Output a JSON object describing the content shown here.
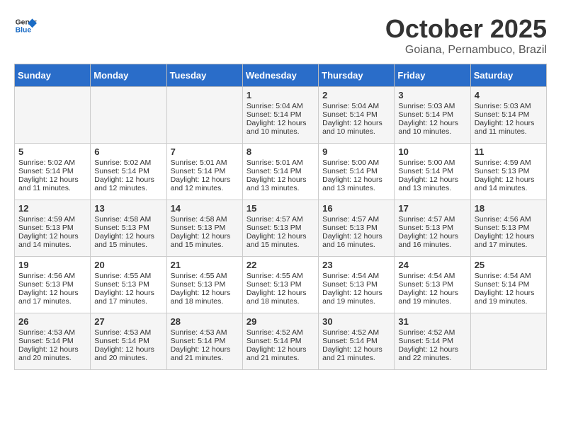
{
  "header": {
    "logo_general": "General",
    "logo_blue": "Blue",
    "month_title": "October 2025",
    "location": "Goiana, Pernambuco, Brazil"
  },
  "days_of_week": [
    "Sunday",
    "Monday",
    "Tuesday",
    "Wednesday",
    "Thursday",
    "Friday",
    "Saturday"
  ],
  "weeks": [
    [
      {
        "day": "",
        "sunrise": "",
        "sunset": "",
        "daylight": ""
      },
      {
        "day": "",
        "sunrise": "",
        "sunset": "",
        "daylight": ""
      },
      {
        "day": "",
        "sunrise": "",
        "sunset": "",
        "daylight": ""
      },
      {
        "day": "1",
        "sunrise": "Sunrise: 5:04 AM",
        "sunset": "Sunset: 5:14 PM",
        "daylight": "Daylight: 12 hours and 10 minutes."
      },
      {
        "day": "2",
        "sunrise": "Sunrise: 5:04 AM",
        "sunset": "Sunset: 5:14 PM",
        "daylight": "Daylight: 12 hours and 10 minutes."
      },
      {
        "day": "3",
        "sunrise": "Sunrise: 5:03 AM",
        "sunset": "Sunset: 5:14 PM",
        "daylight": "Daylight: 12 hours and 10 minutes."
      },
      {
        "day": "4",
        "sunrise": "Sunrise: 5:03 AM",
        "sunset": "Sunset: 5:14 PM",
        "daylight": "Daylight: 12 hours and 11 minutes."
      }
    ],
    [
      {
        "day": "5",
        "sunrise": "Sunrise: 5:02 AM",
        "sunset": "Sunset: 5:14 PM",
        "daylight": "Daylight: 12 hours and 11 minutes."
      },
      {
        "day": "6",
        "sunrise": "Sunrise: 5:02 AM",
        "sunset": "Sunset: 5:14 PM",
        "daylight": "Daylight: 12 hours and 12 minutes."
      },
      {
        "day": "7",
        "sunrise": "Sunrise: 5:01 AM",
        "sunset": "Sunset: 5:14 PM",
        "daylight": "Daylight: 12 hours and 12 minutes."
      },
      {
        "day": "8",
        "sunrise": "Sunrise: 5:01 AM",
        "sunset": "Sunset: 5:14 PM",
        "daylight": "Daylight: 12 hours and 13 minutes."
      },
      {
        "day": "9",
        "sunrise": "Sunrise: 5:00 AM",
        "sunset": "Sunset: 5:14 PM",
        "daylight": "Daylight: 12 hours and 13 minutes."
      },
      {
        "day": "10",
        "sunrise": "Sunrise: 5:00 AM",
        "sunset": "Sunset: 5:14 PM",
        "daylight": "Daylight: 12 hours and 13 minutes."
      },
      {
        "day": "11",
        "sunrise": "Sunrise: 4:59 AM",
        "sunset": "Sunset: 5:13 PM",
        "daylight": "Daylight: 12 hours and 14 minutes."
      }
    ],
    [
      {
        "day": "12",
        "sunrise": "Sunrise: 4:59 AM",
        "sunset": "Sunset: 5:13 PM",
        "daylight": "Daylight: 12 hours and 14 minutes."
      },
      {
        "day": "13",
        "sunrise": "Sunrise: 4:58 AM",
        "sunset": "Sunset: 5:13 PM",
        "daylight": "Daylight: 12 hours and 15 minutes."
      },
      {
        "day": "14",
        "sunrise": "Sunrise: 4:58 AM",
        "sunset": "Sunset: 5:13 PM",
        "daylight": "Daylight: 12 hours and 15 minutes."
      },
      {
        "day": "15",
        "sunrise": "Sunrise: 4:57 AM",
        "sunset": "Sunset: 5:13 PM",
        "daylight": "Daylight: 12 hours and 15 minutes."
      },
      {
        "day": "16",
        "sunrise": "Sunrise: 4:57 AM",
        "sunset": "Sunset: 5:13 PM",
        "daylight": "Daylight: 12 hours and 16 minutes."
      },
      {
        "day": "17",
        "sunrise": "Sunrise: 4:57 AM",
        "sunset": "Sunset: 5:13 PM",
        "daylight": "Daylight: 12 hours and 16 minutes."
      },
      {
        "day": "18",
        "sunrise": "Sunrise: 4:56 AM",
        "sunset": "Sunset: 5:13 PM",
        "daylight": "Daylight: 12 hours and 17 minutes."
      }
    ],
    [
      {
        "day": "19",
        "sunrise": "Sunrise: 4:56 AM",
        "sunset": "Sunset: 5:13 PM",
        "daylight": "Daylight: 12 hours and 17 minutes."
      },
      {
        "day": "20",
        "sunrise": "Sunrise: 4:55 AM",
        "sunset": "Sunset: 5:13 PM",
        "daylight": "Daylight: 12 hours and 17 minutes."
      },
      {
        "day": "21",
        "sunrise": "Sunrise: 4:55 AM",
        "sunset": "Sunset: 5:13 PM",
        "daylight": "Daylight: 12 hours and 18 minutes."
      },
      {
        "day": "22",
        "sunrise": "Sunrise: 4:55 AM",
        "sunset": "Sunset: 5:13 PM",
        "daylight": "Daylight: 12 hours and 18 minutes."
      },
      {
        "day": "23",
        "sunrise": "Sunrise: 4:54 AM",
        "sunset": "Sunset: 5:13 PM",
        "daylight": "Daylight: 12 hours and 19 minutes."
      },
      {
        "day": "24",
        "sunrise": "Sunrise: 4:54 AM",
        "sunset": "Sunset: 5:13 PM",
        "daylight": "Daylight: 12 hours and 19 minutes."
      },
      {
        "day": "25",
        "sunrise": "Sunrise: 4:54 AM",
        "sunset": "Sunset: 5:14 PM",
        "daylight": "Daylight: 12 hours and 19 minutes."
      }
    ],
    [
      {
        "day": "26",
        "sunrise": "Sunrise: 4:53 AM",
        "sunset": "Sunset: 5:14 PM",
        "daylight": "Daylight: 12 hours and 20 minutes."
      },
      {
        "day": "27",
        "sunrise": "Sunrise: 4:53 AM",
        "sunset": "Sunset: 5:14 PM",
        "daylight": "Daylight: 12 hours and 20 minutes."
      },
      {
        "day": "28",
        "sunrise": "Sunrise: 4:53 AM",
        "sunset": "Sunset: 5:14 PM",
        "daylight": "Daylight: 12 hours and 21 minutes."
      },
      {
        "day": "29",
        "sunrise": "Sunrise: 4:52 AM",
        "sunset": "Sunset: 5:14 PM",
        "daylight": "Daylight: 12 hours and 21 minutes."
      },
      {
        "day": "30",
        "sunrise": "Sunrise: 4:52 AM",
        "sunset": "Sunset: 5:14 PM",
        "daylight": "Daylight: 12 hours and 21 minutes."
      },
      {
        "day": "31",
        "sunrise": "Sunrise: 4:52 AM",
        "sunset": "Sunset: 5:14 PM",
        "daylight": "Daylight: 12 hours and 22 minutes."
      },
      {
        "day": "",
        "sunrise": "",
        "sunset": "",
        "daylight": ""
      }
    ]
  ]
}
